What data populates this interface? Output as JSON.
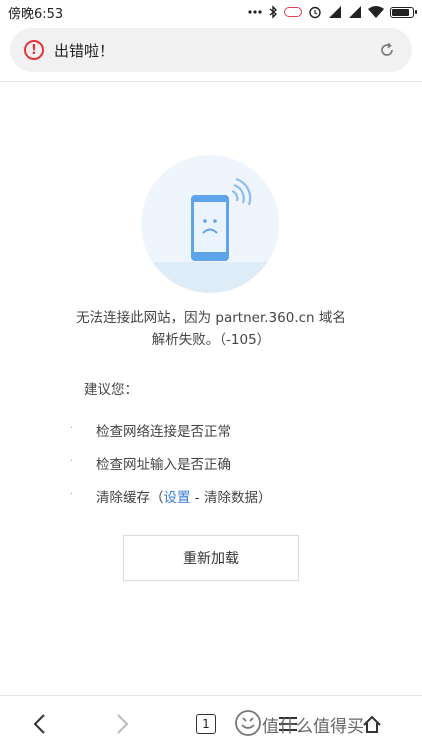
{
  "status_bar": {
    "time": "傍晚6:53",
    "icons": [
      "dots-icon",
      "bluetooth-icon",
      "power-save-icon",
      "alarm-icon",
      "signal-icon",
      "signal-icon",
      "wifi-icon",
      "battery-icon"
    ],
    "battery_level": 0.85
  },
  "address_bar": {
    "title": "出错啦！",
    "status_icon": "error-icon",
    "action_icon": "reload-icon"
  },
  "colors": {
    "error": "#e5353a",
    "link": "#3a7bd5",
    "illustration_bg": "#eef5fc",
    "phone": "#5ea4ea"
  },
  "error": {
    "line1": "无法连接此网站，因为 partner.360.cn 域名",
    "line2": "解析失败。（-105）"
  },
  "suggestions": {
    "title": "建议您：",
    "items": [
      {
        "text": "检查网络连接是否正常"
      },
      {
        "text": "检查网址输入是否正确"
      },
      {
        "prefix": "清除缓存（",
        "link": "设置",
        "suffix": " - 清除数据）"
      }
    ]
  },
  "reload_button": {
    "label": "重新加载"
  },
  "bottom_nav": {
    "tab_count": "1",
    "icons": [
      "back-icon",
      "forward-icon",
      "tabs-icon",
      "menu-icon",
      "home-icon"
    ]
  },
  "watermark": {
    "text": "值什么值得买"
  }
}
